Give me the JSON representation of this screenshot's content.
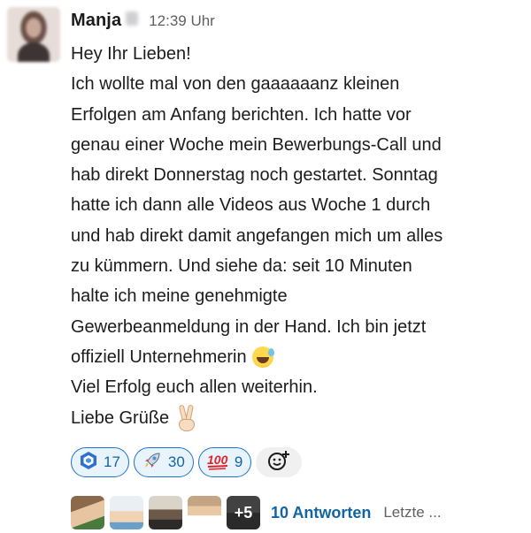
{
  "message": {
    "author": "Manja",
    "timestamp": "12:39 Uhr",
    "lines": [
      "Hey Ihr Lieben!",
      "Ich wollte mal von den gaaaaaanz kleinen",
      "Erfolgen am Anfang berichten. Ich hatte vor",
      "genau einer Woche mein Bewerbungs-Call und",
      "hab direkt Donnerstag noch gestartet. Sonntag",
      "hatte ich dann alle Videos aus Woche 1 durch",
      "und hab direkt damit angefangen mich um alles",
      "zu kümmern. Und siehe da: seit 10 Minuten",
      "halte ich meine genehmigte",
      "Gewerbeanmeldung in der Hand. Ich bin jetzt",
      "offiziell Unternehmerin",
      "Viel Erfolg euch allen weiterhin.",
      "Liebe Grüße"
    ],
    "inline_emojis": [
      {
        "after_line": 10,
        "icon": "grinning-face-with-sweat-icon"
      },
      {
        "after_line": 12,
        "icon": "victory-hand-icon"
      }
    ]
  },
  "reactions": [
    {
      "icon": "hexagon-badge-icon",
      "count": "17"
    },
    {
      "icon": "rocket-icon",
      "count": "30"
    },
    {
      "icon": "hundred-points-icon",
      "count": "9"
    }
  ],
  "add_reaction_icon": "add-reaction-icon",
  "thread": {
    "more_participants": "+5",
    "replies": "10 Antworten",
    "last_reply": "Letzte ..."
  },
  "colors": {
    "accent": "#1264a3",
    "reaction_border": "#1d74c7",
    "reaction_bg": "#e8f3fc",
    "text": "#1d1c1d",
    "muted": "#616061"
  }
}
